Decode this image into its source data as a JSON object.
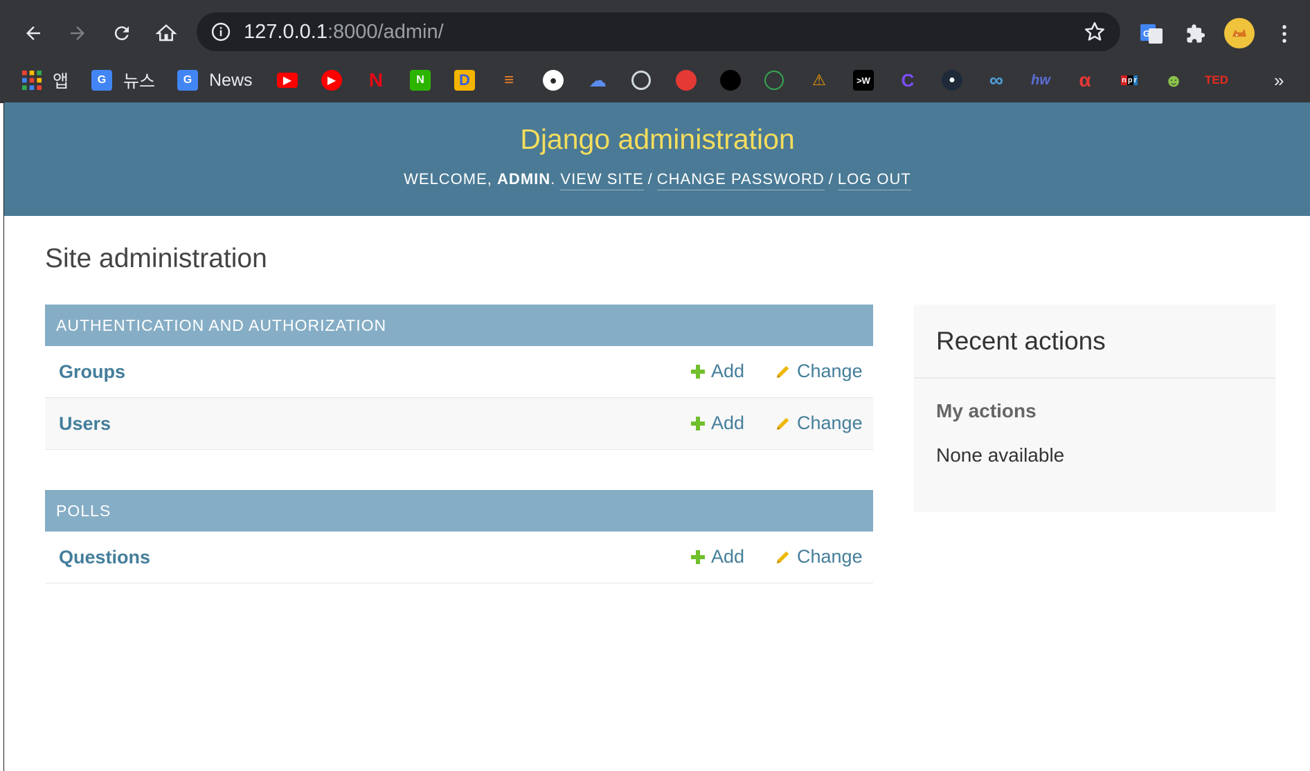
{
  "browser": {
    "url_host": "127.0.0.1",
    "url_rest": ":8000/admin/",
    "bookmarks": {
      "apps_label": "앱",
      "news_ko_label": "뉴스",
      "news_label": "News",
      "ted_label": "TED",
      "more_label": "»"
    }
  },
  "header": {
    "branding": "Django administration",
    "welcome": "WELCOME,",
    "user": "ADMIN",
    "view_site": "VIEW SITE",
    "change_password": "CHANGE PASSWORD",
    "log_out": "LOG OUT"
  },
  "main": {
    "title": "Site administration",
    "modules": [
      {
        "caption": "AUTHENTICATION AND AUTHORIZATION",
        "rows": [
          {
            "name": "Groups",
            "add": "Add",
            "change": "Change"
          },
          {
            "name": "Users",
            "add": "Add",
            "change": "Change"
          }
        ]
      },
      {
        "caption": "POLLS",
        "rows": [
          {
            "name": "Questions",
            "add": "Add",
            "change": "Change"
          }
        ]
      }
    ]
  },
  "sidebar": {
    "title": "Recent actions",
    "subtitle": "My actions",
    "empty": "None available"
  },
  "colors": {
    "header_bg": "#4a7a95",
    "branding": "#f5dd5d",
    "caption_bg": "#85adc5",
    "link": "#447e9b",
    "add_icon": "#70bf2b",
    "change_icon": "#efb80b"
  }
}
